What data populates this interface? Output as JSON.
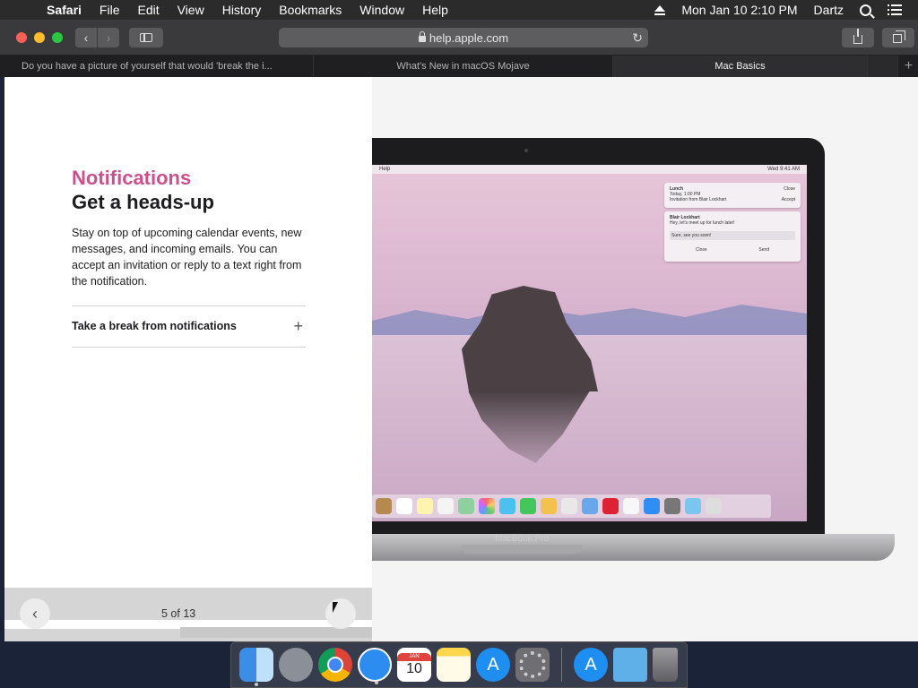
{
  "menubar": {
    "apple": "",
    "app_name": "Safari",
    "items": [
      "File",
      "Edit",
      "View",
      "History",
      "Bookmarks",
      "Window",
      "Help"
    ],
    "clock": "Mon Jan 10  2:10 PM",
    "user": "Dartz"
  },
  "toolbar": {
    "back_glyph": "‹",
    "forward_glyph": "›",
    "url": "help.apple.com",
    "reload_glyph": "↻"
  },
  "tabs": [
    {
      "label": "Do you have a picture of yourself that would 'break the i...",
      "active": false
    },
    {
      "label": "What's New in macOS Mojave",
      "active": false
    },
    {
      "label": "Mac Basics",
      "active": true
    }
  ],
  "new_tab_glyph": "+",
  "article": {
    "kicker": "Notifications",
    "headline": "Get a heads-up",
    "body": "Stay on top of upcoming calendar events, new messages, and incoming emails. You can accept an invitation or reply to a text right from the notification.",
    "accordion_label": "Take a break from notifications",
    "accordion_glyph": "+"
  },
  "pager": {
    "prev_glyph": "‹",
    "count": "5 of 13"
  },
  "illustration": {
    "laptop_label": "MacBook Pro",
    "mini_menubar_app": "Help",
    "mini_menubar_clock": "Wed 9:41 AM",
    "notification_1": {
      "title": "Lunch",
      "line1": "Today, 1:00 PM",
      "line2": "Invitation from Blair Lockhart",
      "action_top": "Close",
      "action_bottom": "Accept"
    },
    "notification_2": {
      "title": "Blair Lockhart",
      "line1": "Hey, let's meet up for lunch later!",
      "reply": "Sure, see you soon!",
      "close": "Close",
      "send": "Send"
    }
  },
  "dock": {
    "calendar_month": "JAN",
    "calendar_day": "10",
    "appstore_glyph": "A"
  },
  "colors": {
    "kicker": "#cd4f8e",
    "close": "#fe5f57",
    "minimize": "#febc2e",
    "maximize": "#28c840"
  }
}
